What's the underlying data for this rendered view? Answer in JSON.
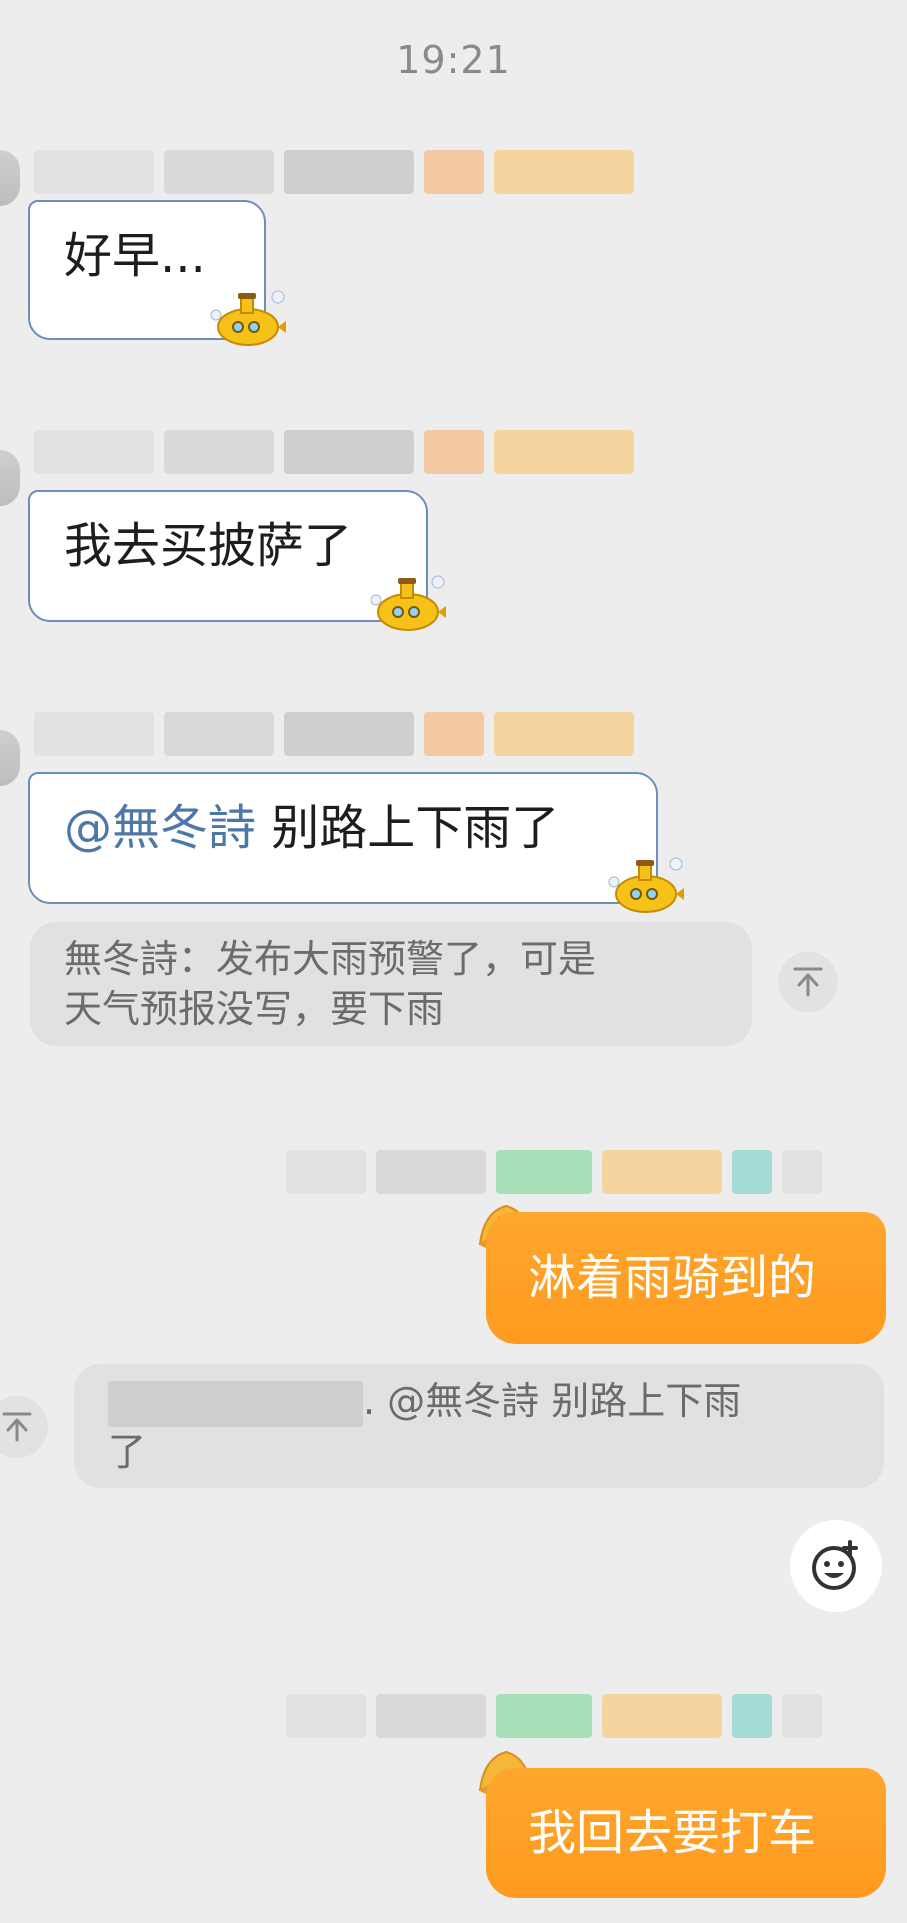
{
  "time": "19:21",
  "messages": [
    {
      "text": "好早..."
    },
    {
      "text": "我去买披萨了"
    },
    {
      "mention": "@無冬詩",
      "text": " 别路上下雨了"
    }
  ],
  "quote1": {
    "line1": "無冬詩：发布大雨预警了，可是",
    "line2": "天气预报没写，要下雨"
  },
  "reply1": {
    "text": "淋着雨骑到的"
  },
  "quote2": {
    "middle": ". @無冬詩 别路上下雨",
    "line2": "了"
  },
  "reply2": {
    "text": "我回去要打车"
  },
  "icons": {
    "sticker": "submarine-icon",
    "jump": "jump-to-top-icon",
    "emoji": "emoji-plus-icon",
    "badge": "bell-icon"
  },
  "colors": {
    "out_bubble": "#ff9f25",
    "mention": "#4d77a6",
    "in_border": "#6b8fb8"
  }
}
